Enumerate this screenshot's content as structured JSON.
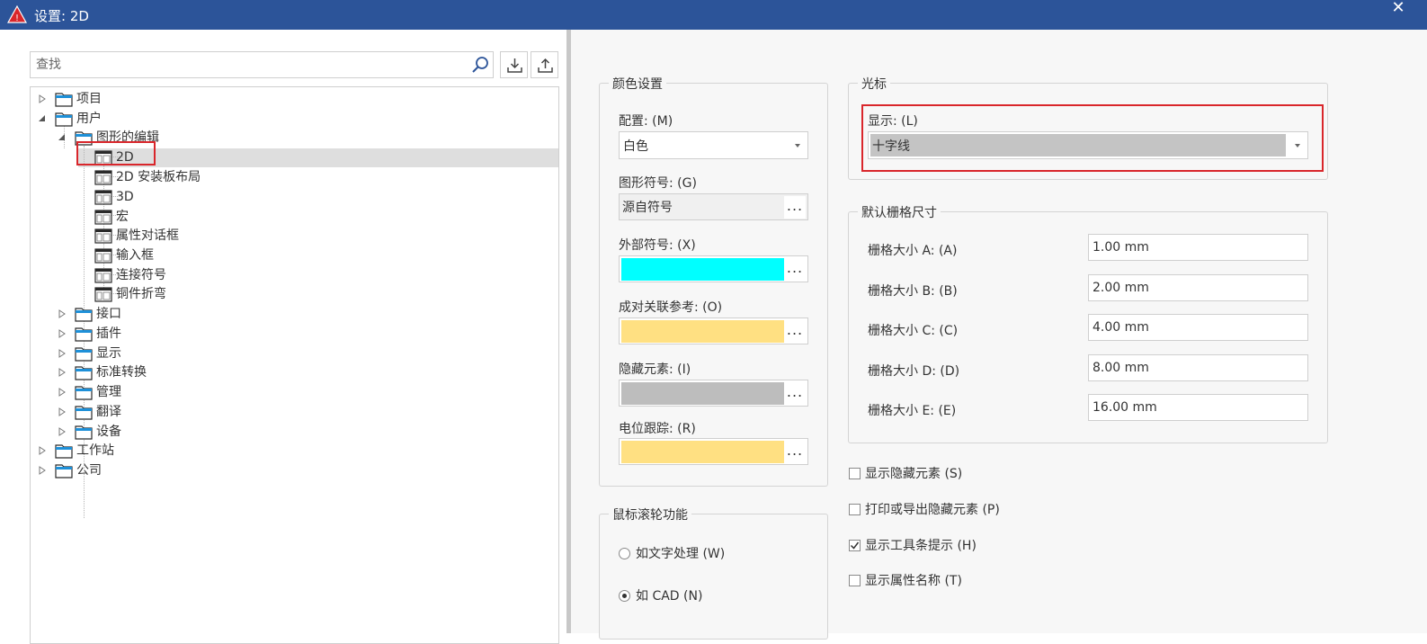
{
  "window": {
    "title": "设置: 2D",
    "close_glyph": "✕"
  },
  "search": {
    "placeholder": "查找"
  },
  "tree": {
    "project": "项目",
    "user": "用户",
    "graphic_editing": "图形的编辑",
    "item_2d": "2D",
    "item_2d_panel": "2D 安装板布局",
    "item_3d": "3D",
    "item_macro": "宏",
    "item_prop_dialog": "属性对话框",
    "item_input_box": "输入框",
    "item_connector": "连接符号",
    "item_copper_bend": "铜件折弯",
    "interface": "接口",
    "plugin": "插件",
    "display": "显示",
    "standard_conversion": "标准转换",
    "management": "管理",
    "translation": "翻译",
    "device": "设备",
    "workstation": "工作站",
    "company": "公司"
  },
  "color_settings": {
    "legend": "颜色设置",
    "config_label": "配置: (M)",
    "config_value": "白色",
    "graphic_symbol_label": "图形符号: (G)",
    "graphic_symbol_value": "源自符号",
    "external_symbol_label": "外部符号: (X)",
    "external_symbol_color": "#00ffff",
    "paired_ref_label": "成对关联参考: (O)",
    "paired_ref_color": "#ffe082",
    "hidden_elem_label": "隐藏元素: (I)",
    "hidden_elem_color": "#bdbdbd",
    "potential_trace_label": "电位跟踪: (R)",
    "potential_trace_color": "#ffe082",
    "dots": "..."
  },
  "mouse_wheel": {
    "legend": "鼠标滚轮功能",
    "option_word": "如文字处理 (W)",
    "option_cad": "如 CAD  (N)",
    "selected": "cad"
  },
  "cursor": {
    "legend": "光标",
    "display_label": "显示: (L)",
    "display_value": "十字线"
  },
  "grid": {
    "legend": "默认栅格尺寸",
    "a_label": "栅格大小 A: (A)",
    "a_value": "1.00 mm",
    "b_label": "栅格大小 B: (B)",
    "b_value": "2.00 mm",
    "c_label": "栅格大小 C: (C)",
    "c_value": "4.00 mm",
    "d_label": "栅格大小 D: (D)",
    "d_value": "8.00 mm",
    "e_label": "栅格大小 E: (E)",
    "e_value": "16.00 mm"
  },
  "options": {
    "show_hidden": {
      "label": "显示隐藏元素 (S)",
      "checked": false
    },
    "print_hidden": {
      "label": "打印或导出隐藏元素 (P)",
      "checked": false
    },
    "show_tooltips": {
      "label": "显示工具条提示 (H)",
      "checked": true
    },
    "show_prop_names": {
      "label": "显示属性名称 (T)",
      "checked": false
    }
  },
  "colors": {
    "titlebar": "#2c5499",
    "highlight_red": "#d9262b",
    "selected_row": "#dedede",
    "folder_blue": "#1e90d8"
  }
}
